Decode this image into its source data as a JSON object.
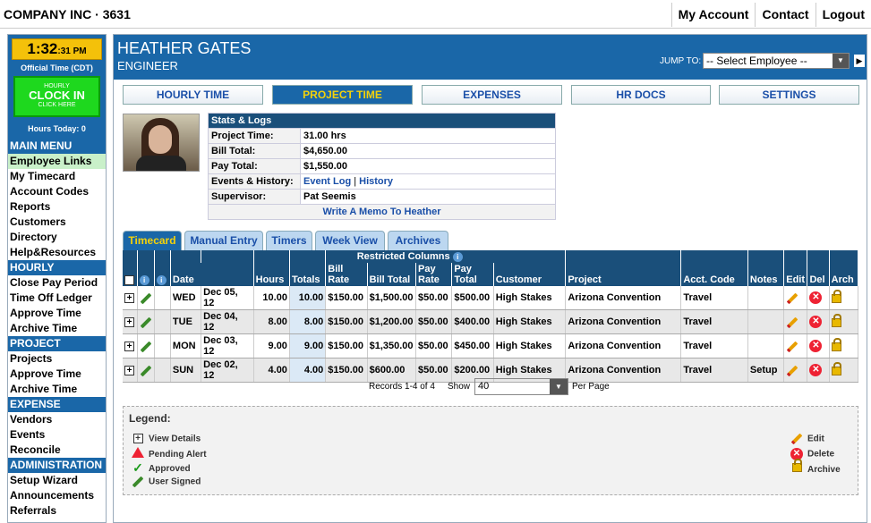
{
  "topbar": {
    "company": "COMPANY INC · 3631",
    "links": [
      "My Account",
      "Contact",
      "Logout"
    ]
  },
  "sidebar": {
    "clock_time": "1:32",
    "clock_ampm": ":31 PM",
    "official": "Official Time (CDT)",
    "clockin_top": "HOURLY",
    "clockin_main": "CLOCK IN",
    "clockin_sub": "CLICK HERE",
    "hours_today": "Hours Today: 0",
    "sections": [
      {
        "title": "MAIN MENU",
        "items": [
          "Employee Links",
          "My Timecard",
          "Account Codes",
          "Reports",
          "Customers",
          "Directory",
          "Help&Resources"
        ]
      },
      {
        "title": "HOURLY",
        "items": [
          "Close Pay Period",
          "Time Off Ledger",
          "Approve Time",
          "Archive Time"
        ]
      },
      {
        "title": "PROJECT",
        "items": [
          "Projects",
          "Approve Time",
          "Archive Time"
        ]
      },
      {
        "title": "EXPENSE",
        "items": [
          "Vendors",
          "Events",
          "Reconcile"
        ]
      },
      {
        "title": "ADMINISTRATION",
        "items": [
          "Setup Wizard",
          "Announcements",
          "Referrals"
        ]
      }
    ]
  },
  "header": {
    "name": "HEATHER GATES",
    "title": "ENGINEER",
    "jump_label": "JUMP TO:",
    "select_value": "-- Select Employee --"
  },
  "nav": [
    "HOURLY TIME",
    "PROJECT TIME",
    "EXPENSES",
    "HR DOCS",
    "SETTINGS"
  ],
  "stats": {
    "heading": "Stats & Logs",
    "project_time_label": "Project Time:",
    "project_time": "31.00 hrs",
    "bill_total_label": "Bill Total:",
    "bill_total": "$4,650.00",
    "pay_total_label": "Pay Total:",
    "pay_total": "$1,550.00",
    "events_label": "Events & History:",
    "event_log": "Event Log",
    "sep": "|",
    "history": "History",
    "supervisor_label": "Supervisor:",
    "supervisor": "Pat Seemis",
    "memo": "Write A Memo To Heather"
  },
  "tabs": [
    "Timecard",
    "Manual Entry",
    "Timers",
    "Week View",
    "Archives"
  ],
  "grid": {
    "restricted": "Restricted Columns",
    "headers": [
      "Date",
      "Hours",
      "Totals",
      "Bill Rate",
      "Bill Total",
      "Pay Rate",
      "Pay Total",
      "Customer",
      "Project",
      "Acct. Code",
      "Notes",
      "Edit",
      "Del",
      "Arch"
    ],
    "rows": [
      {
        "day": "WED",
        "date": "Dec 05, 12",
        "hours": "10.00",
        "totals": "10.00",
        "bill_rate": "$150.00",
        "bill_total": "$1,500.00",
        "pay_rate": "$50.00",
        "pay_total": "$500.00",
        "customer": "High Stakes",
        "project": "Arizona Convention",
        "acct": "Travel",
        "notes": ""
      },
      {
        "day": "TUE",
        "date": "Dec 04, 12",
        "hours": "8.00",
        "totals": "8.00",
        "bill_rate": "$150.00",
        "bill_total": "$1,200.00",
        "pay_rate": "$50.00",
        "pay_total": "$400.00",
        "customer": "High Stakes",
        "project": "Arizona Convention",
        "acct": "Travel",
        "notes": ""
      },
      {
        "day": "MON",
        "date": "Dec 03, 12",
        "hours": "9.00",
        "totals": "9.00",
        "bill_rate": "$150.00",
        "bill_total": "$1,350.00",
        "pay_rate": "$50.00",
        "pay_total": "$450.00",
        "customer": "High Stakes",
        "project": "Arizona Convention",
        "acct": "Travel",
        "notes": ""
      },
      {
        "day": "SUN",
        "date": "Dec 02, 12",
        "hours": "4.00",
        "totals": "4.00",
        "bill_rate": "$150.00",
        "bill_total": "$600.00",
        "pay_rate": "$50.00",
        "pay_total": "$200.00",
        "customer": "High Stakes",
        "project": "Arizona Convention",
        "acct": "Travel",
        "notes": "Setup"
      }
    ]
  },
  "paging": {
    "records": "Records 1-4 of 4",
    "show": "Show",
    "value": "40",
    "per_page": "Per Page"
  },
  "legend": {
    "title": "Legend:",
    "view": "View Details",
    "pending": "Pending Alert",
    "approved": "Approved",
    "signed": "User Signed",
    "edit": "Edit",
    "delete": "Delete",
    "archive": "Archive"
  }
}
